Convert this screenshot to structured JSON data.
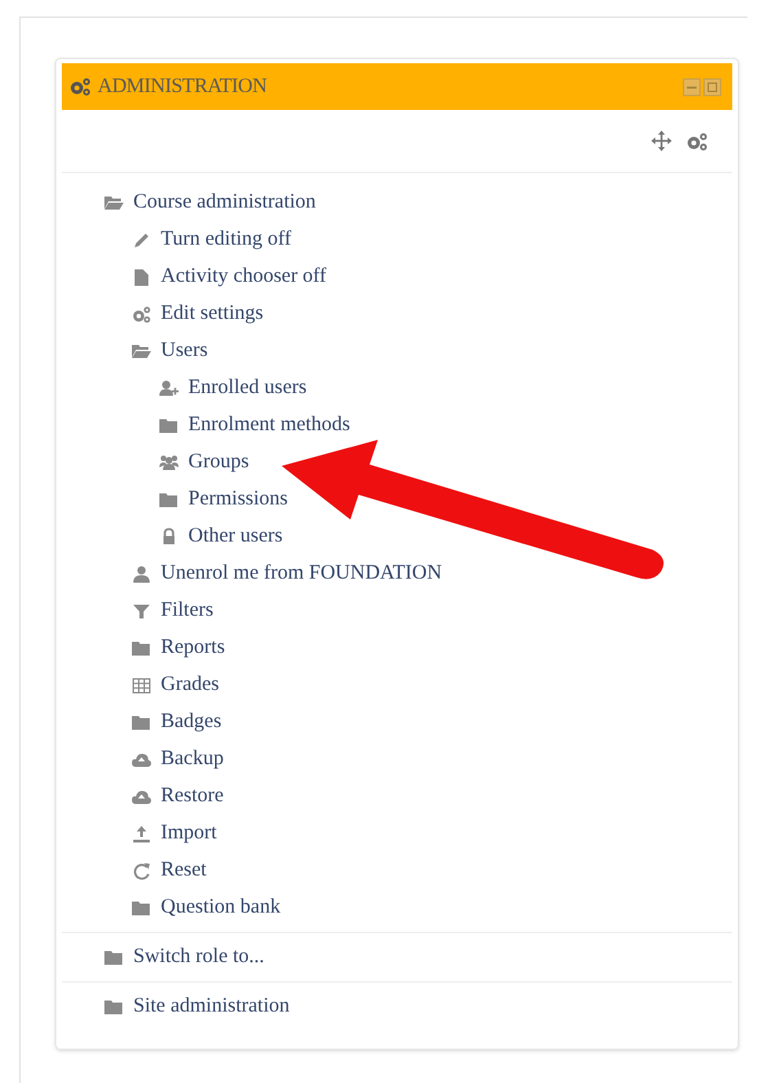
{
  "block": {
    "title": "ADMINISTRATION"
  },
  "tree": [
    {
      "label": "Course administration",
      "kind": "branch",
      "expanded": true,
      "children": [
        {
          "label": "Turn editing off",
          "kind": "pencil"
        },
        {
          "label": "Activity chooser off",
          "kind": "file"
        },
        {
          "label": "Edit settings",
          "kind": "gears"
        },
        {
          "label": "Users",
          "kind": "branch",
          "expanded": true,
          "children": [
            {
              "label": "Enrolled users",
              "kind": "user-plus"
            },
            {
              "label": "Enrolment methods",
              "kind": "branch",
              "expanded": false
            },
            {
              "label": "Groups",
              "kind": "users"
            },
            {
              "label": "Permissions",
              "kind": "branch",
              "expanded": false
            },
            {
              "label": "Other users",
              "kind": "lock"
            }
          ]
        },
        {
          "label": "Unenrol me from FOUNDATION",
          "kind": "user"
        },
        {
          "label": "Filters",
          "kind": "filter"
        },
        {
          "label": "Reports",
          "kind": "branch",
          "expanded": false
        },
        {
          "label": "Grades",
          "kind": "table"
        },
        {
          "label": "Badges",
          "kind": "branch",
          "expanded": false
        },
        {
          "label": "Backup",
          "kind": "cloud"
        },
        {
          "label": "Restore",
          "kind": "cloud"
        },
        {
          "label": "Import",
          "kind": "upload"
        },
        {
          "label": "Reset",
          "kind": "reset"
        },
        {
          "label": "Question bank",
          "kind": "branch",
          "expanded": false
        }
      ]
    },
    {
      "label": "Switch role to...",
      "kind": "branch",
      "expanded": false
    },
    {
      "label": "Site administration",
      "kind": "branch",
      "expanded": false
    }
  ]
}
